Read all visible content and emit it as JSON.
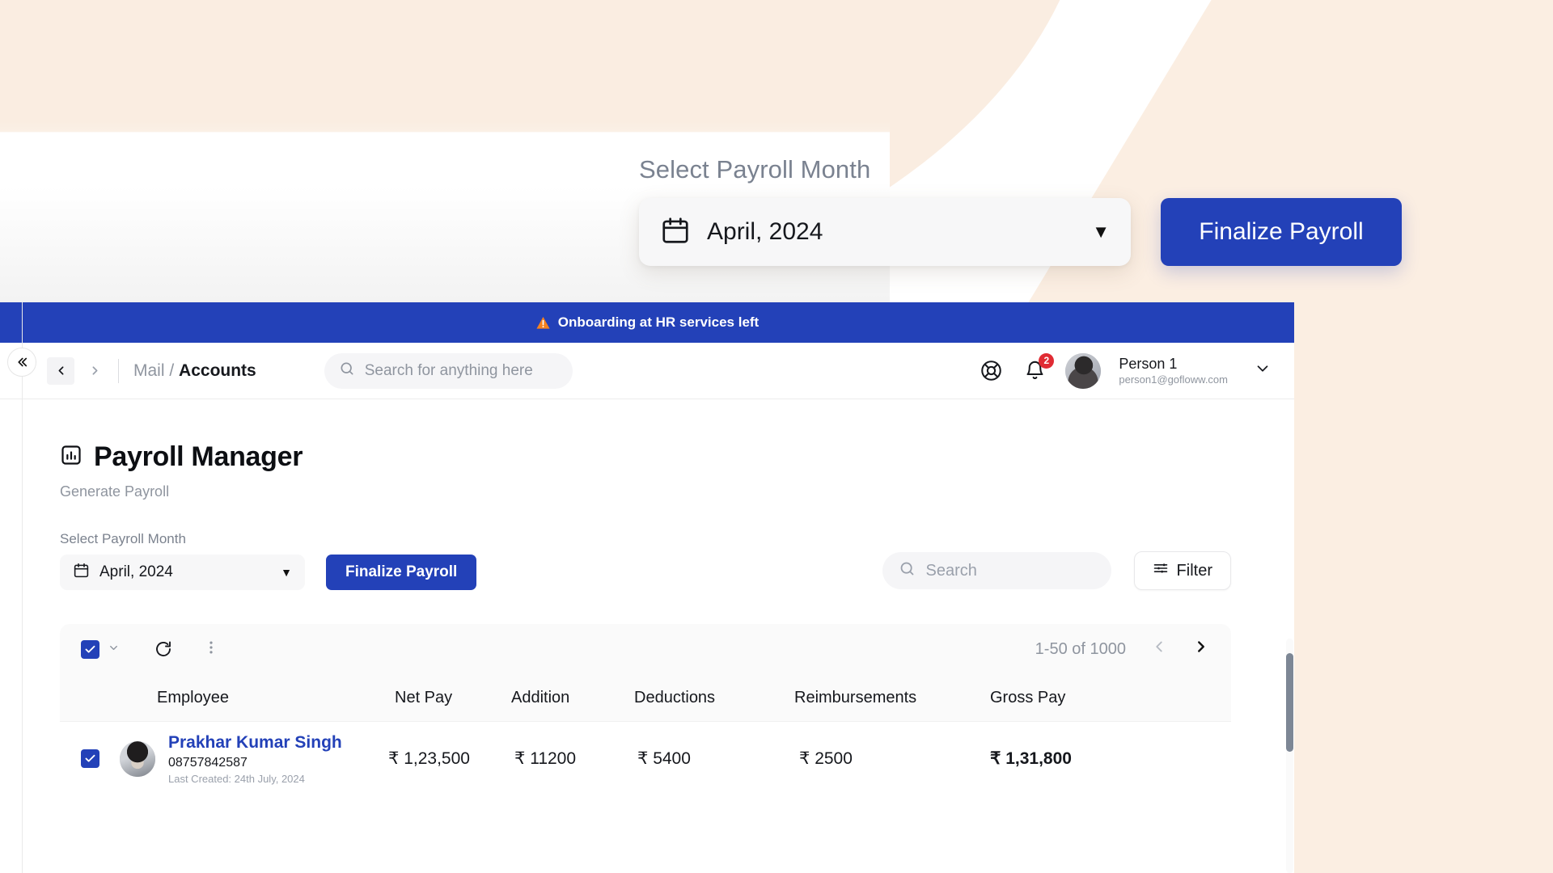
{
  "overlay": {
    "label": "Select Payroll Month",
    "month_value": "April, 2024",
    "finalize_label": "Finalize Payroll",
    "calendar_icon": "calendar-icon",
    "caret_icon": "caret-down-icon"
  },
  "banner": {
    "icon": "warning-triangle-icon",
    "text": "Onboarding at HR services left",
    "bg_color": "#2341B8"
  },
  "topbar": {
    "collapse_icon": "double-chevron-left-icon",
    "back_icon": "chevron-left-icon",
    "forward_icon": "chevron-right-icon",
    "breadcrumb_parent": "Mail",
    "breadcrumb_separator": "/",
    "breadcrumb_current": "Accounts",
    "search_placeholder": "Search for anything here",
    "search_value": "",
    "search_icon": "search-icon",
    "help_icon": "lifebuoy-icon",
    "bell_icon": "bell-icon",
    "notification_count": "2",
    "avatar_icon": "user-avatar",
    "user_name": "Person 1",
    "user_email": "person1@gofloww.com",
    "user_chevron_icon": "chevron-down-icon"
  },
  "page": {
    "title_icon": "bar-chart-icon",
    "title": "Payroll Manager",
    "subtitle": "Generate Payroll"
  },
  "controls": {
    "month_label": "Select Payroll Month",
    "month_value": "April, 2024",
    "month_calendar_icon": "calendar-icon",
    "month_caret_icon": "caret-down-icon",
    "finalize_label": "Finalize Payroll",
    "search_placeholder": "Search",
    "search_value": "",
    "search_icon": "search-icon",
    "filter_label": "Filter",
    "filter_icon": "sliders-icon"
  },
  "table_toolbar": {
    "select_all_checked": true,
    "select_all_icon": "checkbox-checked-icon",
    "select_dropdown_icon": "chevron-down-icon",
    "refresh_icon": "refresh-icon",
    "more_icon": "three-dots-vertical-icon",
    "pagination_text": "1-50 of 1000",
    "prev_icon": "chevron-left-icon",
    "next_icon": "chevron-right-icon"
  },
  "table": {
    "columns": [
      "Employee",
      "Net Pay",
      "Addition",
      "Deductions",
      "Reimbursements",
      "Gross Pay"
    ],
    "rows": [
      {
        "checked": true,
        "avatar": "employee-photo",
        "name": "Prakhar Kumar Singh",
        "phone": "08757842587",
        "last_created": "Last Created: 24th July, 2024",
        "net_pay": "₹ 1,23,500",
        "addition": "₹ 11200",
        "deductions": "₹ 5400",
        "reimbursements": "₹ 2500",
        "gross_pay": "₹ 1,31,800"
      }
    ]
  },
  "colors": {
    "brand_blue": "#2341B8",
    "link_blue": "#2341B8",
    "badge_red": "#E02B33",
    "warning_orange": "#F5821F",
    "cream_bg": "#FAEDE1",
    "muted_text": "#8F959F"
  }
}
